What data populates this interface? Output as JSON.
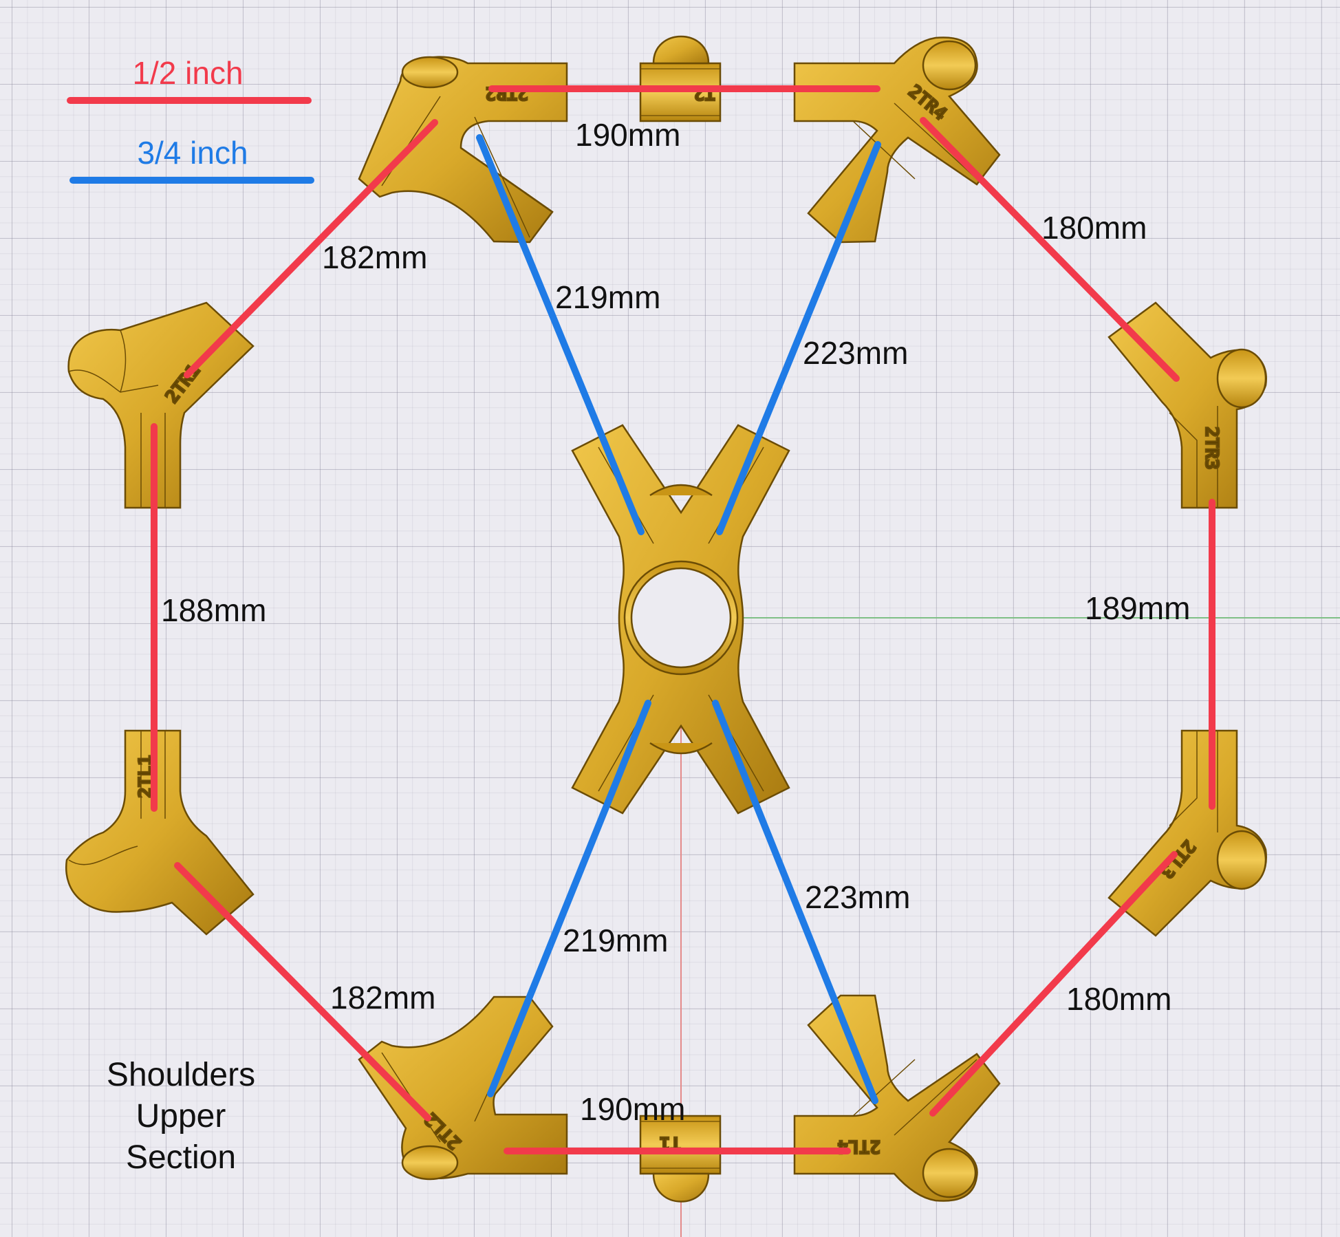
{
  "legend": {
    "half_inch": {
      "label": "1/2 inch",
      "color": "#f23a4b"
    },
    "three_quarter_inch": {
      "label": "3/4 inch",
      "color": "#1f7be6"
    }
  },
  "caption": [
    "Shoulders",
    "Upper",
    "Section"
  ],
  "parts": {
    "tr2": "2TR2",
    "t2": "T2",
    "tr4": "2TR4",
    "tr1": "2TR1",
    "tr3": "2TR3",
    "tl1": "2TL1",
    "tl3": "2TL3",
    "tl2": "2TL2",
    "t1": "T1",
    "tl4": "2TL4"
  },
  "measurements": {
    "top": "190mm",
    "upper_left": "182mm",
    "upper_right": "180mm",
    "inner_upper_left": "219mm",
    "inner_upper_right": "223mm",
    "left": "188mm",
    "right": "189mm",
    "inner_lower_left": "219mm",
    "inner_lower_right": "223mm",
    "lower_left": "182mm",
    "lower_right": "180mm",
    "bottom": "190mm"
  },
  "colors": {
    "part_fill": "#d9a92a",
    "part_stroke": "#6b4c05",
    "background": "#ecebf1"
  }
}
